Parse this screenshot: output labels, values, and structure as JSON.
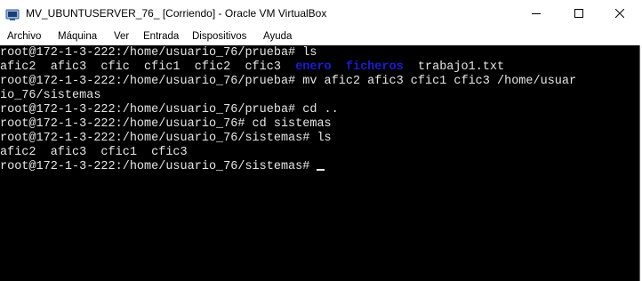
{
  "window": {
    "title": "MV_UBUNTUSERVER_76_ [Corriendo] - Oracle VM VirtualBox"
  },
  "menu": [
    "Archivo",
    "Máquina",
    "Ver",
    "Entrada",
    "Dispositivos",
    "Ayuda"
  ],
  "terminal": {
    "line1": "root@172-1-3-222:/home/usuario_76/prueba# ls",
    "line2_files": "afic2  afic3  cfic  cfic1  cfic2  cfic3  ",
    "line2_dir1": "enero",
    "line2_gap": "  ",
    "line2_dir2": "ficheros",
    "line2_tail": "  trabajo1.txt",
    "line3": "root@172-1-3-222:/home/usuario_76/prueba# mv afic2 afic3 cfic1 cfic3 /home/usuar",
    "line4": "io_76/sistemas",
    "line5": "root@172-1-3-222:/home/usuario_76/prueba# cd ..",
    "line6": "root@172-1-3-222:/home/usuario_76# cd sistemas",
    "line7": "root@172-1-3-222:/home/usuario_76/sistemas# ls",
    "line8": "afic2  afic3  cfic1  cfic3",
    "line9": "root@172-1-3-222:/home/usuario_76/sistemas# "
  },
  "colors": {
    "terminal_bg": "#000000",
    "terminal_fg": "#e6e6e6",
    "directory_color": "#1b1bd6"
  }
}
